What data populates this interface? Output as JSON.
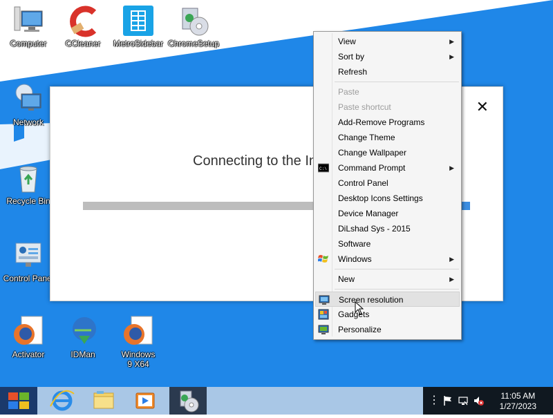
{
  "desktop": {
    "icons": [
      {
        "label": "Computer",
        "icon": "computer-icon"
      },
      {
        "label": "CCleaner",
        "icon": "ccleaner-icon"
      },
      {
        "label": "MetroSidebar",
        "icon": "metro-sidebar-icon"
      },
      {
        "label": "ChromeSetup",
        "icon": "chrome-setup-icon"
      },
      {
        "label": "Network",
        "icon": "network-icon"
      },
      {
        "label": "Recycle Bin",
        "icon": "recycle-bin-icon"
      },
      {
        "label": "Control Panel",
        "icon": "control-panel-icon"
      },
      {
        "label": "Activator",
        "icon": "firefox-icon"
      },
      {
        "label": "IDMan",
        "icon": "idman-icon"
      },
      {
        "label": "Windows 9 X64",
        "icon": "firefox-icon"
      }
    ]
  },
  "dialog": {
    "status_text": "Connecting to the In",
    "close_symbol": "✕",
    "progress": 0.6
  },
  "context_menu": {
    "items": [
      {
        "label": "View",
        "submenu": true,
        "enabled": true
      },
      {
        "label": "Sort by",
        "submenu": true,
        "enabled": true
      },
      {
        "label": "Refresh",
        "submenu": false,
        "enabled": true
      },
      {
        "label": "Paste",
        "submenu": false,
        "enabled": false
      },
      {
        "label": "Paste shortcut",
        "submenu": false,
        "enabled": false
      },
      {
        "label": "Add-Remove Programs",
        "submenu": false,
        "enabled": true
      },
      {
        "label": "Change Theme",
        "submenu": false,
        "enabled": true
      },
      {
        "label": "Change Wallpaper",
        "submenu": false,
        "enabled": true
      },
      {
        "label": "Command Prompt",
        "submenu": true,
        "enabled": true,
        "icon": "command-prompt-icon"
      },
      {
        "label": "Control Panel",
        "submenu": false,
        "enabled": true
      },
      {
        "label": "Desktop Icons Settings",
        "submenu": false,
        "enabled": true
      },
      {
        "label": "Device Manager",
        "submenu": false,
        "enabled": true
      },
      {
        "label": "DiLshad Sys - 2015",
        "submenu": false,
        "enabled": true
      },
      {
        "label": "Software",
        "submenu": false,
        "enabled": true
      },
      {
        "label": "Windows",
        "submenu": true,
        "enabled": true,
        "icon": "windows-logo-icon"
      },
      {
        "label": "New",
        "submenu": true,
        "enabled": true
      },
      {
        "label": "Screen resolution",
        "submenu": false,
        "enabled": true,
        "icon": "screen-resolution-icon",
        "highlighted": true
      },
      {
        "label": "Gadgets",
        "submenu": false,
        "enabled": true,
        "icon": "gadgets-icon"
      },
      {
        "label": "Personalize",
        "submenu": false,
        "enabled": true,
        "icon": "personalize-icon"
      }
    ]
  },
  "taskbar": {
    "pinned": [
      "internet-explorer-icon",
      "file-explorer-icon",
      "media-player-icon",
      "chrome-setup-icon"
    ],
    "tray_icons": [
      "show-hidden-icon",
      "action-center-flag-icon",
      "network-icon",
      "volume-muted-icon"
    ],
    "time": "11:05 AM",
    "date": "1/27/2023"
  },
  "colors": {
    "wallpaper_blue": "#1f87e8",
    "taskbar": "#a9c7e6",
    "tray": "#101820",
    "menu_bg": "#f5f5f5",
    "menu_hover": "#e2e2e2"
  }
}
